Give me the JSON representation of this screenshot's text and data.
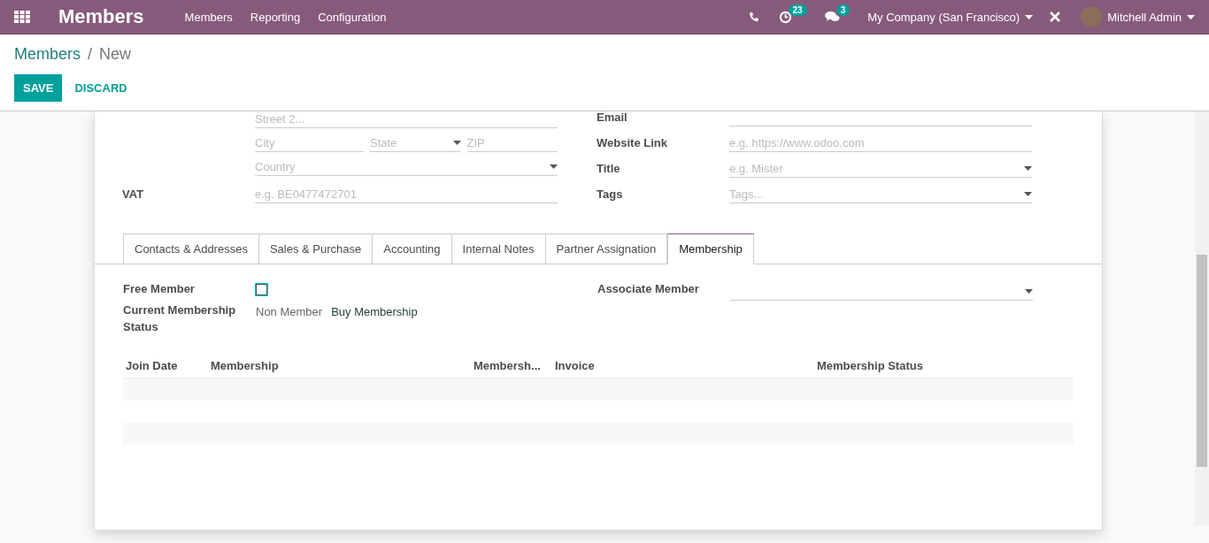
{
  "navbar": {
    "app_title": "Members",
    "menu": [
      "Members",
      "Reporting",
      "Configuration"
    ],
    "activity_count": "23",
    "message_count": "3",
    "company": "My Company (San Francisco)",
    "user": "Mitchell Admin"
  },
  "breadcrumb": {
    "parent": "Members",
    "separator": "/",
    "current": "New"
  },
  "actions": {
    "save": "SAVE",
    "discard": "DISCARD"
  },
  "address_fields": [
    {
      "placeholder": "Street 2..."
    }
  ],
  "address_row": [
    {
      "placeholder": "City",
      "kind": "text"
    },
    {
      "placeholder": "State",
      "kind": "select"
    },
    {
      "placeholder": "ZIP",
      "kind": "text"
    }
  ],
  "country_field": {
    "placeholder": "Country",
    "kind": "select"
  },
  "vat": {
    "label": "VAT",
    "placeholder": "e.g. BE0477472701"
  },
  "right_fields": [
    {
      "label": "Email",
      "kind": "text"
    },
    {
      "label": "Website Link",
      "placeholder": "e.g. https://www.odoo.com",
      "kind": "text"
    },
    {
      "label": "Title",
      "placeholder": "e.g. Mister",
      "kind": "select"
    },
    {
      "label": "Tags",
      "placeholder": "Tags...",
      "kind": "select"
    }
  ],
  "tabs": [
    {
      "label": "Contacts & Addresses",
      "selected": false
    },
    {
      "label": "Sales & Purchase",
      "selected": false
    },
    {
      "label": "Accounting",
      "selected": false
    },
    {
      "label": "Internal Notes",
      "selected": false
    },
    {
      "label": "Partner Assignation",
      "selected": false
    },
    {
      "label": "Membership",
      "selected": true
    }
  ],
  "membership": {
    "free_member": {
      "label": "Free Member",
      "checked": false
    },
    "status": {
      "label": "Current Membership Status",
      "value": "Non Member",
      "action": "Buy Membership"
    },
    "associate": {
      "label": "Associate Member",
      "kind": "select"
    }
  },
  "table": {
    "columns": [
      "Join Date",
      "Membership",
      "Membersh...",
      "Invoice",
      "Membership Status"
    ]
  }
}
